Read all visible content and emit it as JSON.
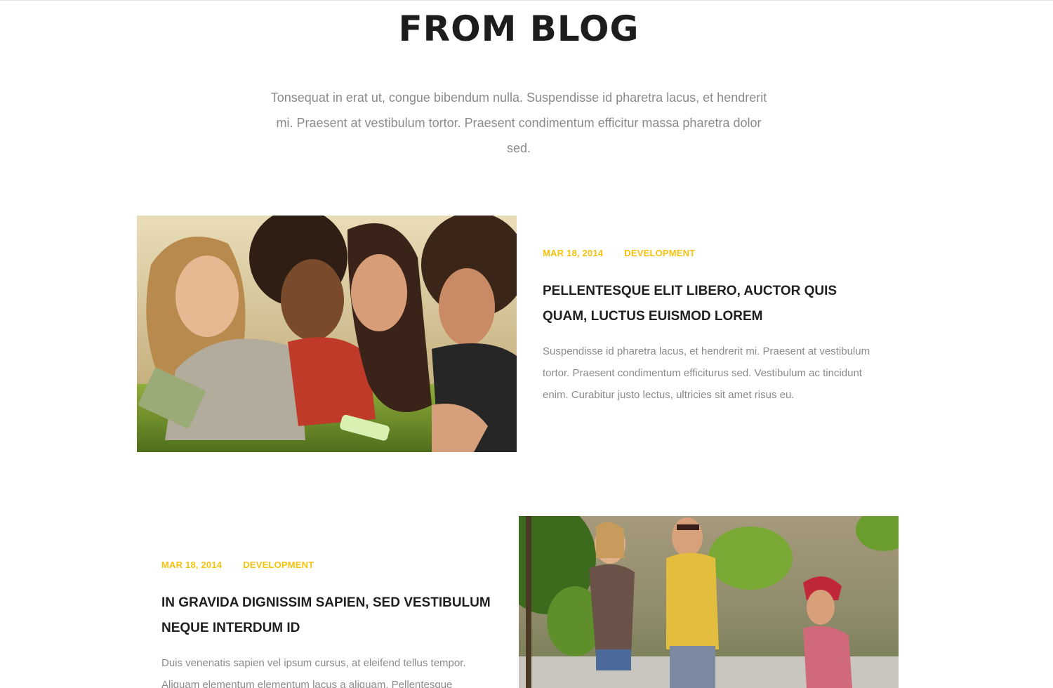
{
  "section": {
    "title": "FROM BLOG",
    "intro": "Tonsequat in erat ut, congue bibendum nulla. Suspendisse id pharetra lacus, et hendrerit mi. Praesent at vestibulum tortor. Praesent condimentum efficitur massa pharetra dolor sed."
  },
  "posts": [
    {
      "date": "MAR 18, 2014",
      "category": "DEVELOPMENT",
      "title": "PELLENTESQUE ELIT LIBERO, AUCTOR QUIS QUAM, LUCTUS EUISMOD LOREM",
      "excerpt": "Suspendisse id pharetra lacus, et hendrerit mi. Praesent at vestibulum tortor. Praesent condimentum efficiturus sed. Vestibulum ac tincidunt enim. Curabitur justo lectus, ultricies sit amet risus eu."
    },
    {
      "date": "MAR 18, 2014",
      "category": "DEVELOPMENT",
      "title": "IN GRAVIDA DIGNISSIM SAPIEN, SED VESTIBULUM NEQUE INTERDUM ID",
      "excerpt": "Duis venenatis sapien vel ipsum cursus, at eleifend tellus tempor. Aliquam elementum elementum lacus a aliquam. Pellentesque"
    }
  ]
}
